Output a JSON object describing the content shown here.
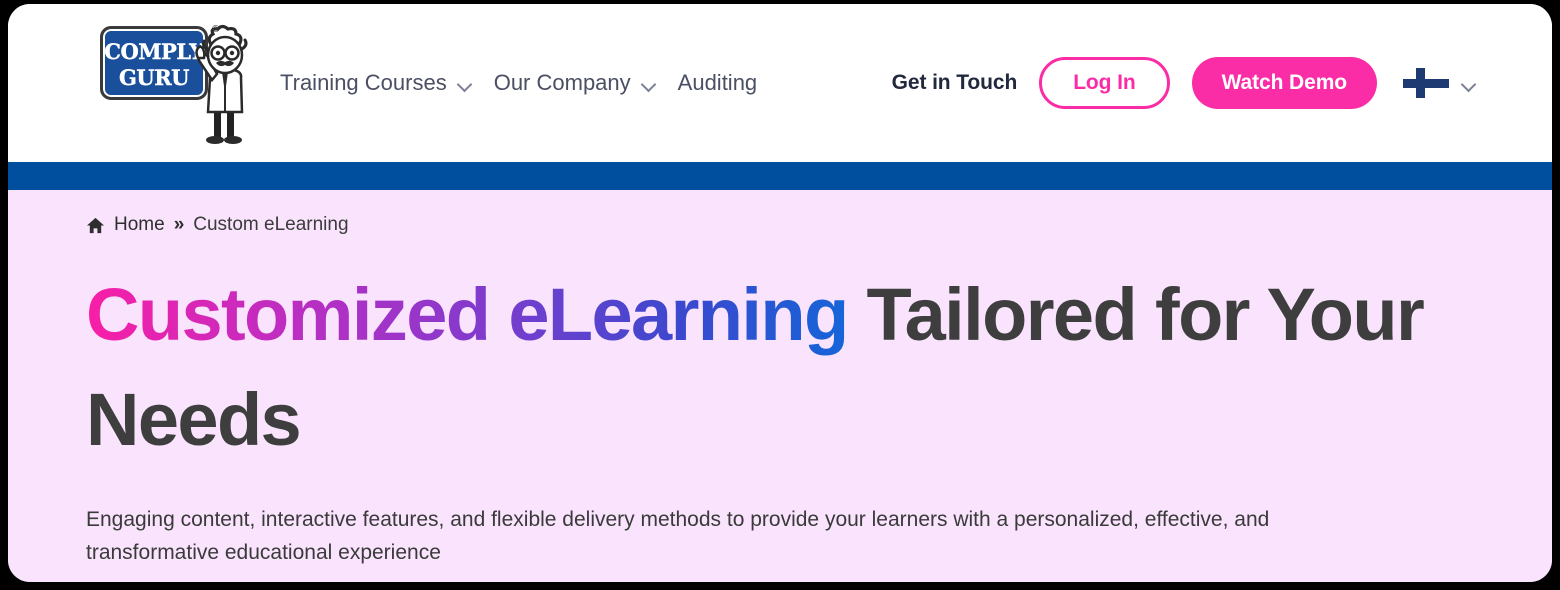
{
  "brand": {
    "logo_line1": "COMPLY",
    "logo_line2": "GURU",
    "registered_mark": "®"
  },
  "nav": {
    "items": [
      {
        "label": "Training Courses",
        "has_dropdown": true
      },
      {
        "label": "Our Company",
        "has_dropdown": true
      },
      {
        "label": "Auditing",
        "has_dropdown": false
      }
    ]
  },
  "actions": {
    "get_in_touch": "Get in Touch",
    "login": "Log In",
    "watch_demo": "Watch Demo",
    "language": "Finnish"
  },
  "breadcrumb": {
    "home": "Home",
    "separator": "»",
    "current": "Custom eLearning"
  },
  "hero": {
    "title_gradient": "Customized eLearning",
    "title_rest": " Tailored for Your Needs",
    "subtitle": "Engaging content, interactive features, and flexible delivery methods to provide your learners with a personalized, effective, and transformative educational experience"
  },
  "colors": {
    "accent_pink": "#FB2DA6",
    "brand_blue": "#004F9F",
    "logo_blue": "#1A4F9C",
    "hero_background": "#F9E3FD",
    "heading_dark": "#3E3E3E",
    "gradient_start": "#F91EA6",
    "gradient_end": "#1565D8"
  }
}
